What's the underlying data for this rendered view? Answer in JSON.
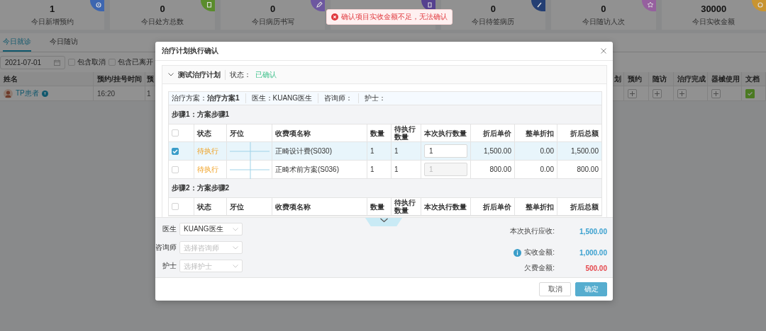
{
  "stats": [
    {
      "value": "1",
      "label": "今日新增预约",
      "color": "#3d66b0"
    },
    {
      "value": "0",
      "label": "今日处方总数",
      "color": "#5a8c2c"
    },
    {
      "value": "0",
      "label": "今日病历书写",
      "color": "#6d57a0"
    },
    {
      "color": "#55408f"
    },
    {
      "value": "0",
      "label": "今日待签病历",
      "color": "#243f73"
    },
    {
      "value": "0",
      "label": "今日随访人次",
      "color": "#96609f"
    },
    {
      "value": "30000",
      "label": "今日实收金额",
      "color": "#c89431"
    }
  ],
  "tabs": [
    {
      "label": "今日就诊",
      "selected": true
    },
    {
      "label": "今日随访",
      "selected": false
    }
  ],
  "filters": {
    "date": "2021-07-01",
    "options": [
      {
        "label": "包含取消",
        "checked": false
      },
      {
        "label": "包含已离开",
        "checked": false
      }
    ]
  },
  "visits": {
    "left_columns": [
      "姓名",
      "预约/挂号时间",
      "预"
    ],
    "right_columns": [
      "划",
      "预约",
      "随访",
      "治疗完成",
      "器械使用",
      "文档"
    ],
    "rows": [
      {
        "name": "TP患者",
        "time": "16:20",
        "column_3": "1",
        "actions": [
          {
            "kind": "add"
          },
          {
            "kind": "add"
          },
          {
            "kind": "add"
          },
          {
            "kind": "add"
          },
          {
            "kind": "done"
          }
        ]
      }
    ]
  },
  "toast": {
    "message": "确认项目实收金额不足，无法确认"
  },
  "modal": {
    "title": "治疗计划执行确认",
    "plan": {
      "name": "测试治疗计划",
      "expanded": true,
      "status_label": "状态：",
      "status": "已确认"
    },
    "info": [
      {
        "label": "治疗方案：",
        "value": "治疗方案1"
      },
      {
        "label": "医生：",
        "value": "KUANG医生"
      },
      {
        "label": "咨询师："
      },
      {
        "label": "护士："
      }
    ],
    "steps": [
      {
        "title": "步骤1：方案步骤1",
        "all_checked": false,
        "columns": [
          "状态",
          "牙位",
          "收费项名称",
          "数量",
          "待执行数量",
          "本次执行数量",
          "折后单价",
          "整单折扣",
          "折后总额"
        ],
        "rows": [
          {
            "checked": true,
            "status": "待执行",
            "item": "正畸设计费(S030)",
            "quantity": "1",
            "pending": "1",
            "execute_qty": "1",
            "disabled": false,
            "unit_price": "1,500.00",
            "discount": "0.00",
            "total": "1,500.00"
          },
          {
            "checked": false,
            "status": "待执行",
            "item": "正畸术前方案(S036)",
            "quantity": "1",
            "pending": "1",
            "execute_qty": "1",
            "disabled": true,
            "unit_price": "800.00",
            "discount": "0.00",
            "total": "800.00"
          }
        ]
      },
      {
        "title": "步骤2：方案步骤2",
        "all_checked": false,
        "columns": [
          "状态",
          "牙位",
          "收费项名称",
          "数量",
          "待执行数量",
          "本次执行数量",
          "折后单价",
          "整单折扣",
          "折后总额"
        ]
      }
    ],
    "staff": [
      {
        "label": "医生",
        "value": "KUANG医生"
      },
      {
        "label": "咨询师",
        "placeholder": "选择咨询师"
      },
      {
        "label": "护士",
        "placeholder": "选择护士"
      }
    ],
    "totals": [
      {
        "label": "本次执行应收:",
        "value": "1,500.00",
        "kind": "due",
        "info": false
      },
      {
        "label": "实收金额:",
        "value": "1,000.00",
        "kind": "paid",
        "info": true
      },
      {
        "label": "欠费金额:",
        "value": "500.00",
        "kind": "owed",
        "info": false
      }
    ],
    "buttons": [
      {
        "label": "取消",
        "kind": "secondary"
      },
      {
        "label": "确定",
        "kind": "primary"
      }
    ]
  }
}
